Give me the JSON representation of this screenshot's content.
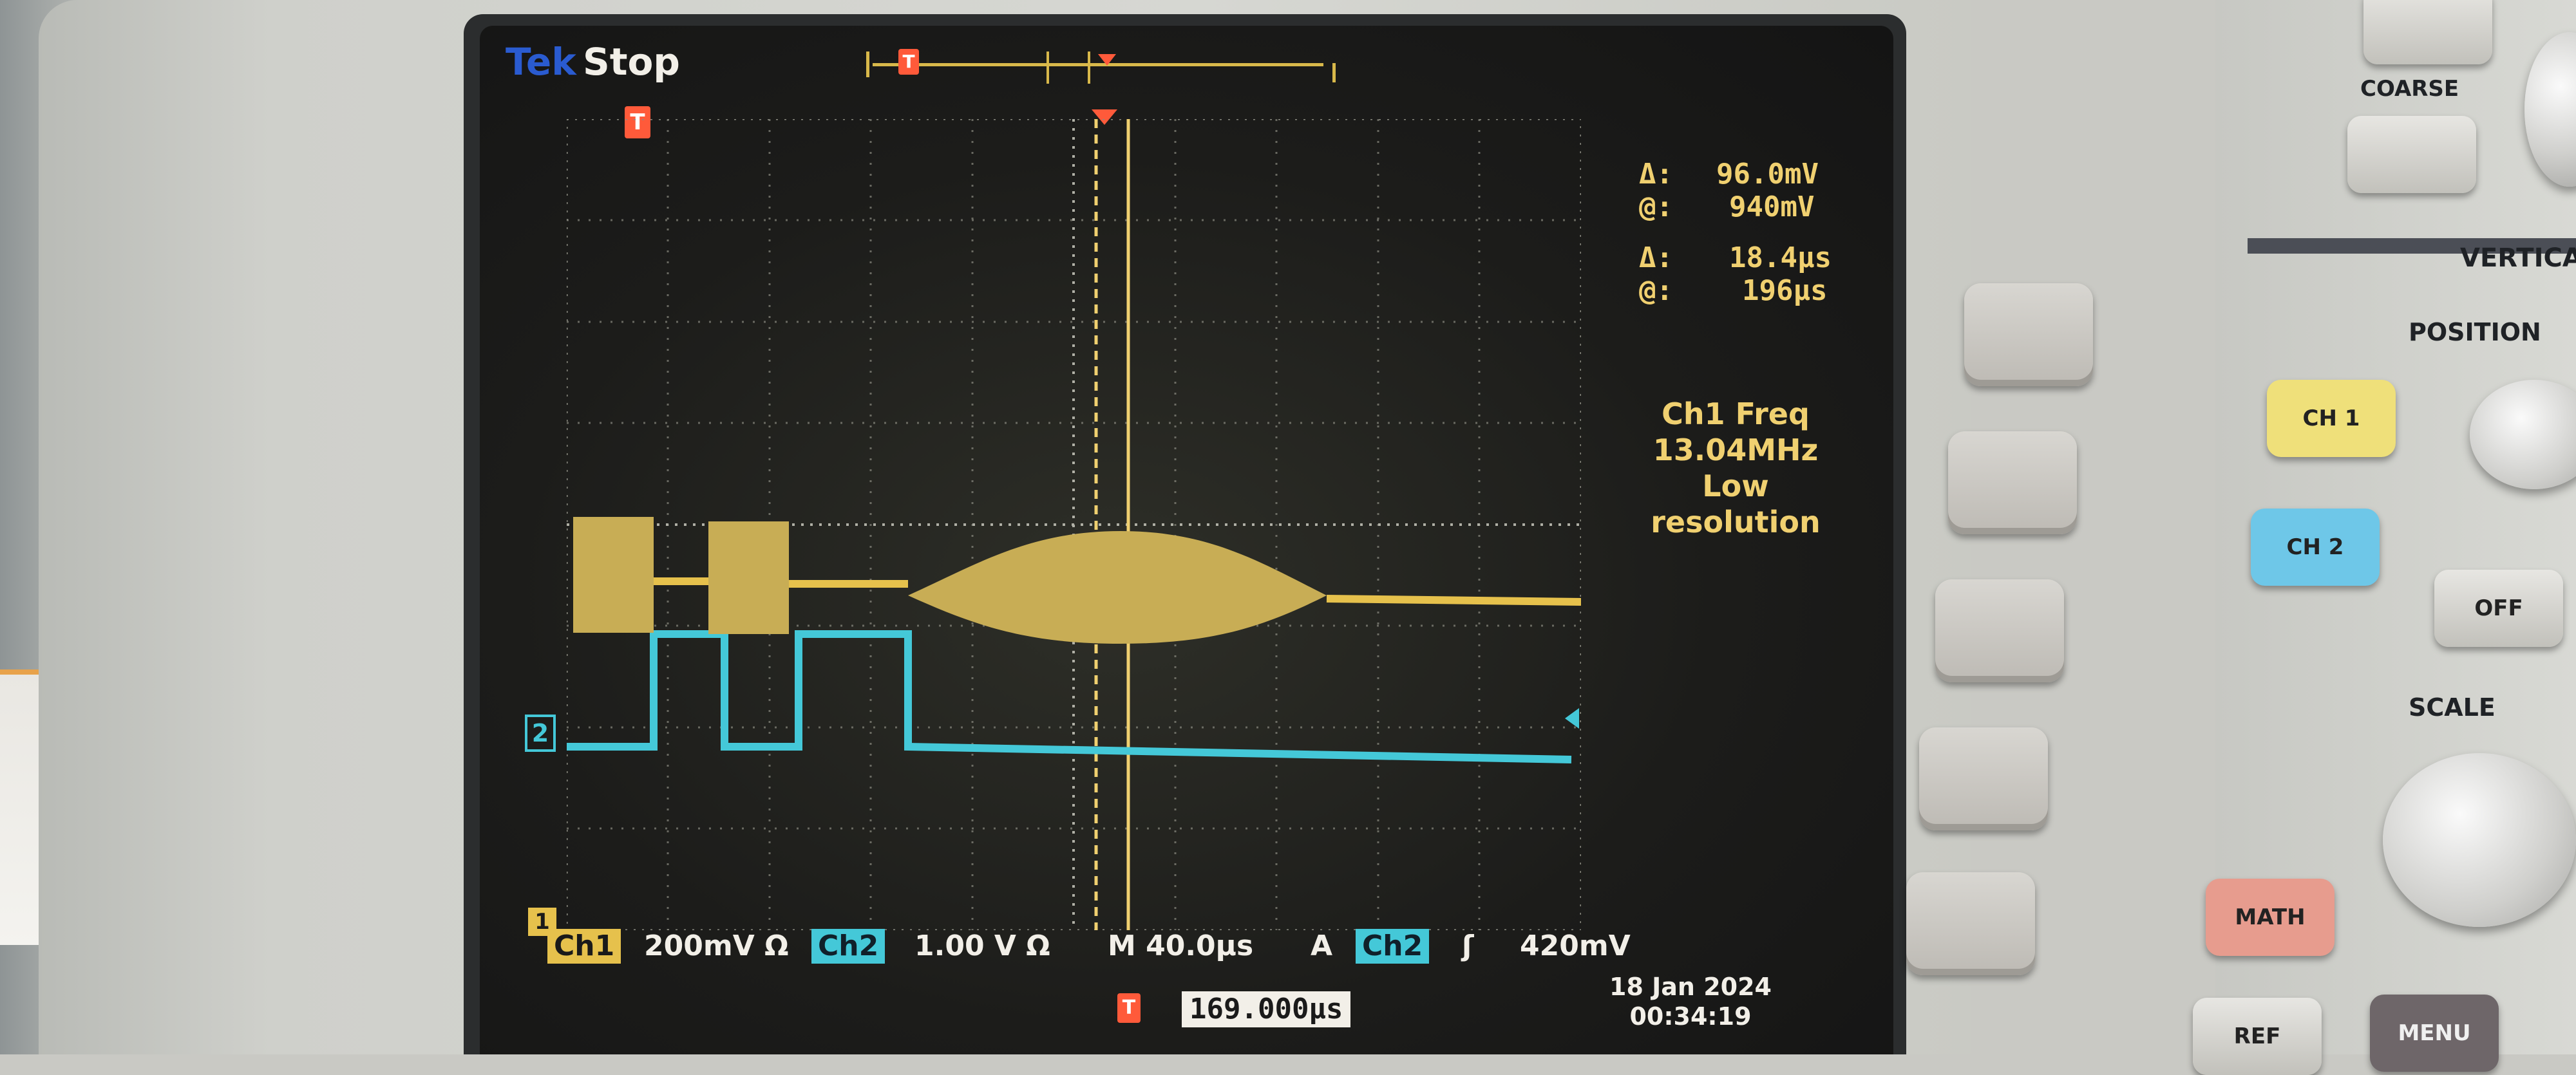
{
  "scope": {
    "brand": "Tek",
    "run_state": "Stop",
    "trigger_marker": "T",
    "ch2_marker": "2",
    "ch1_marker": "1"
  },
  "cursors": {
    "voltage_delta": "96.0mV",
    "voltage_at": "940mV",
    "time_delta": "18.4µs",
    "time_at": "196µs",
    "delta_symbol": "Δ:",
    "at_symbol": "@:"
  },
  "measurement": {
    "line1": "Ch1 Freq",
    "line2": "13.04MHz",
    "line3": "Low",
    "line4": "resolution"
  },
  "status_bar": {
    "ch1_label": "Ch1",
    "ch1_scale": "200mV Ω",
    "ch2_label": "Ch2",
    "ch2_scale": "1.00 V Ω",
    "timebase": "M 40.0µs",
    "trigger_mode": "A",
    "trigger_source": "Ch2",
    "trigger_slope": "ʃ",
    "trigger_level": "420mV"
  },
  "trigger_position": "169.000µs",
  "date": "18 Jan  2024",
  "time": "00:34:19",
  "front_panel": {
    "coarse": "COARSE",
    "vertical": "VERTICAL",
    "position": "POSITION",
    "scale": "SCALE",
    "ch1_button": "CH 1",
    "ch2_button": "CH 2",
    "off_button": "OFF",
    "math_button": "MATH",
    "ref_button": "REF",
    "menu_button": "MENU"
  },
  "colors": {
    "ch1": "#e6c14c",
    "ch2": "#44c8d8",
    "trigger": "#ff5a3a"
  }
}
